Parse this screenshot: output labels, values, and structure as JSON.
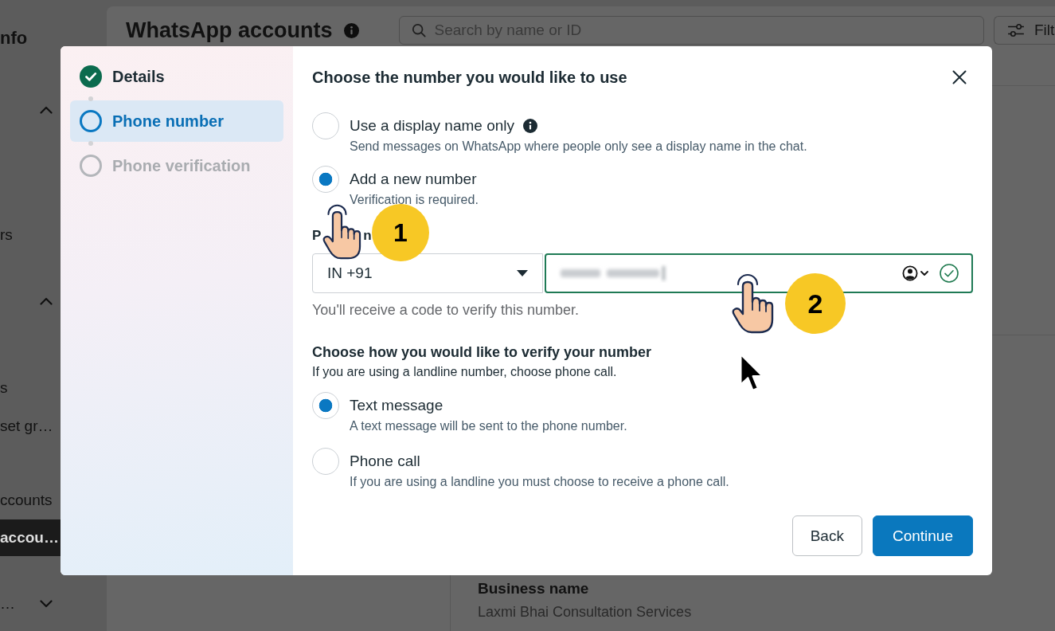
{
  "sidebar": {
    "items": [
      {
        "kind": "heading",
        "label": "nfo"
      },
      {
        "kind": "section",
        "expanded": true
      },
      {
        "kind": "link",
        "label": "rs",
        "selected": false
      },
      {
        "kind": "section",
        "expanded": true
      },
      {
        "kind": "link",
        "label": "s",
        "selected": false
      },
      {
        "kind": "link",
        "label": "set gr…",
        "selected": false
      },
      {
        "kind": "link",
        "label": "ccounts",
        "selected": false
      },
      {
        "kind": "link",
        "label": "accou…",
        "selected": true
      },
      {
        "kind": "section",
        "label": "…",
        "expanded": false
      }
    ]
  },
  "header": {
    "title": "WhatsApp accounts",
    "search": {
      "placeholder": "Search by name or ID"
    },
    "filter_button": "Filt"
  },
  "details": {
    "fields": [
      {
        "label": "Business name",
        "value": "Laxmi Bhai Consultation Services"
      }
    ]
  },
  "dialog": {
    "steps": [
      {
        "label": "Details",
        "completed": true,
        "selected": false
      },
      {
        "label": "Phone number",
        "completed": false,
        "selected": true
      },
      {
        "label": "Phone verification",
        "completed": false,
        "selected": false
      }
    ],
    "title": "Choose the number you would like to use",
    "number_options": [
      {
        "label": "Use a display name only",
        "description": "Send messages on WhatsApp where people only see a display name in the chat.",
        "info": true,
        "selected": false
      },
      {
        "label": "Add a new number",
        "description": "Verification is required.",
        "info": false,
        "selected": true
      }
    ],
    "phone": {
      "label_fragments": [
        "P",
        "n"
      ],
      "country": "IN +91",
      "valid": true,
      "hint": "You'll receive a code to verify this number."
    },
    "verify": {
      "title": "Choose how you would like to verify your number",
      "subtitle": "If you are using a landline number, choose phone call.",
      "options": [
        {
          "label": "Text message",
          "description": "A text message will be sent to the phone number.",
          "selected": true
        },
        {
          "label": "Phone call",
          "description": "If you are using a landline you must choose to receive a phone call.",
          "selected": false
        }
      ]
    },
    "buttons": [
      {
        "label": "Back",
        "kind": "secondary"
      },
      {
        "label": "Continue",
        "kind": "primary"
      }
    ]
  },
  "annotations": [
    {
      "number": "1"
    },
    {
      "number": "2"
    }
  ]
}
